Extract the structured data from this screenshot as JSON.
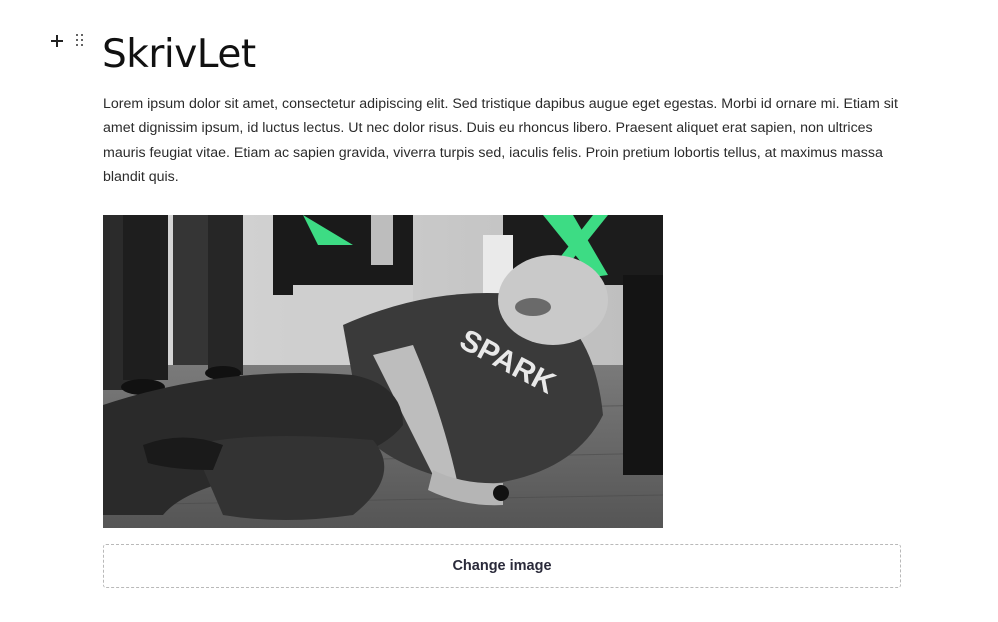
{
  "block": {
    "add_icon": "plus-icon",
    "drag_icon": "drag-handle-icon"
  },
  "page": {
    "title": "SkrivLet",
    "paragraph": "Lorem ipsum dolor sit amet, consectetur adipiscing elit. Sed tristique dapibus augue eget egestas. Morbi id ornare mi. Etiam sit amet dignissim ipsum, id luctus lectus. Ut nec dolor risus. Duis eu rhoncus libero. Praesent aliquet erat sapien, non ultrices mauris feugiat vitae. Etiam ac sapien gravida, viverra turpis sed, iaculis felis. Proin pretium lobortis tellus, at maximus massa blandit quis."
  },
  "image": {
    "shirt_text": "SPARK",
    "accent_color": "#3ddc84"
  },
  "actions": {
    "change_image_label": "Change image"
  }
}
